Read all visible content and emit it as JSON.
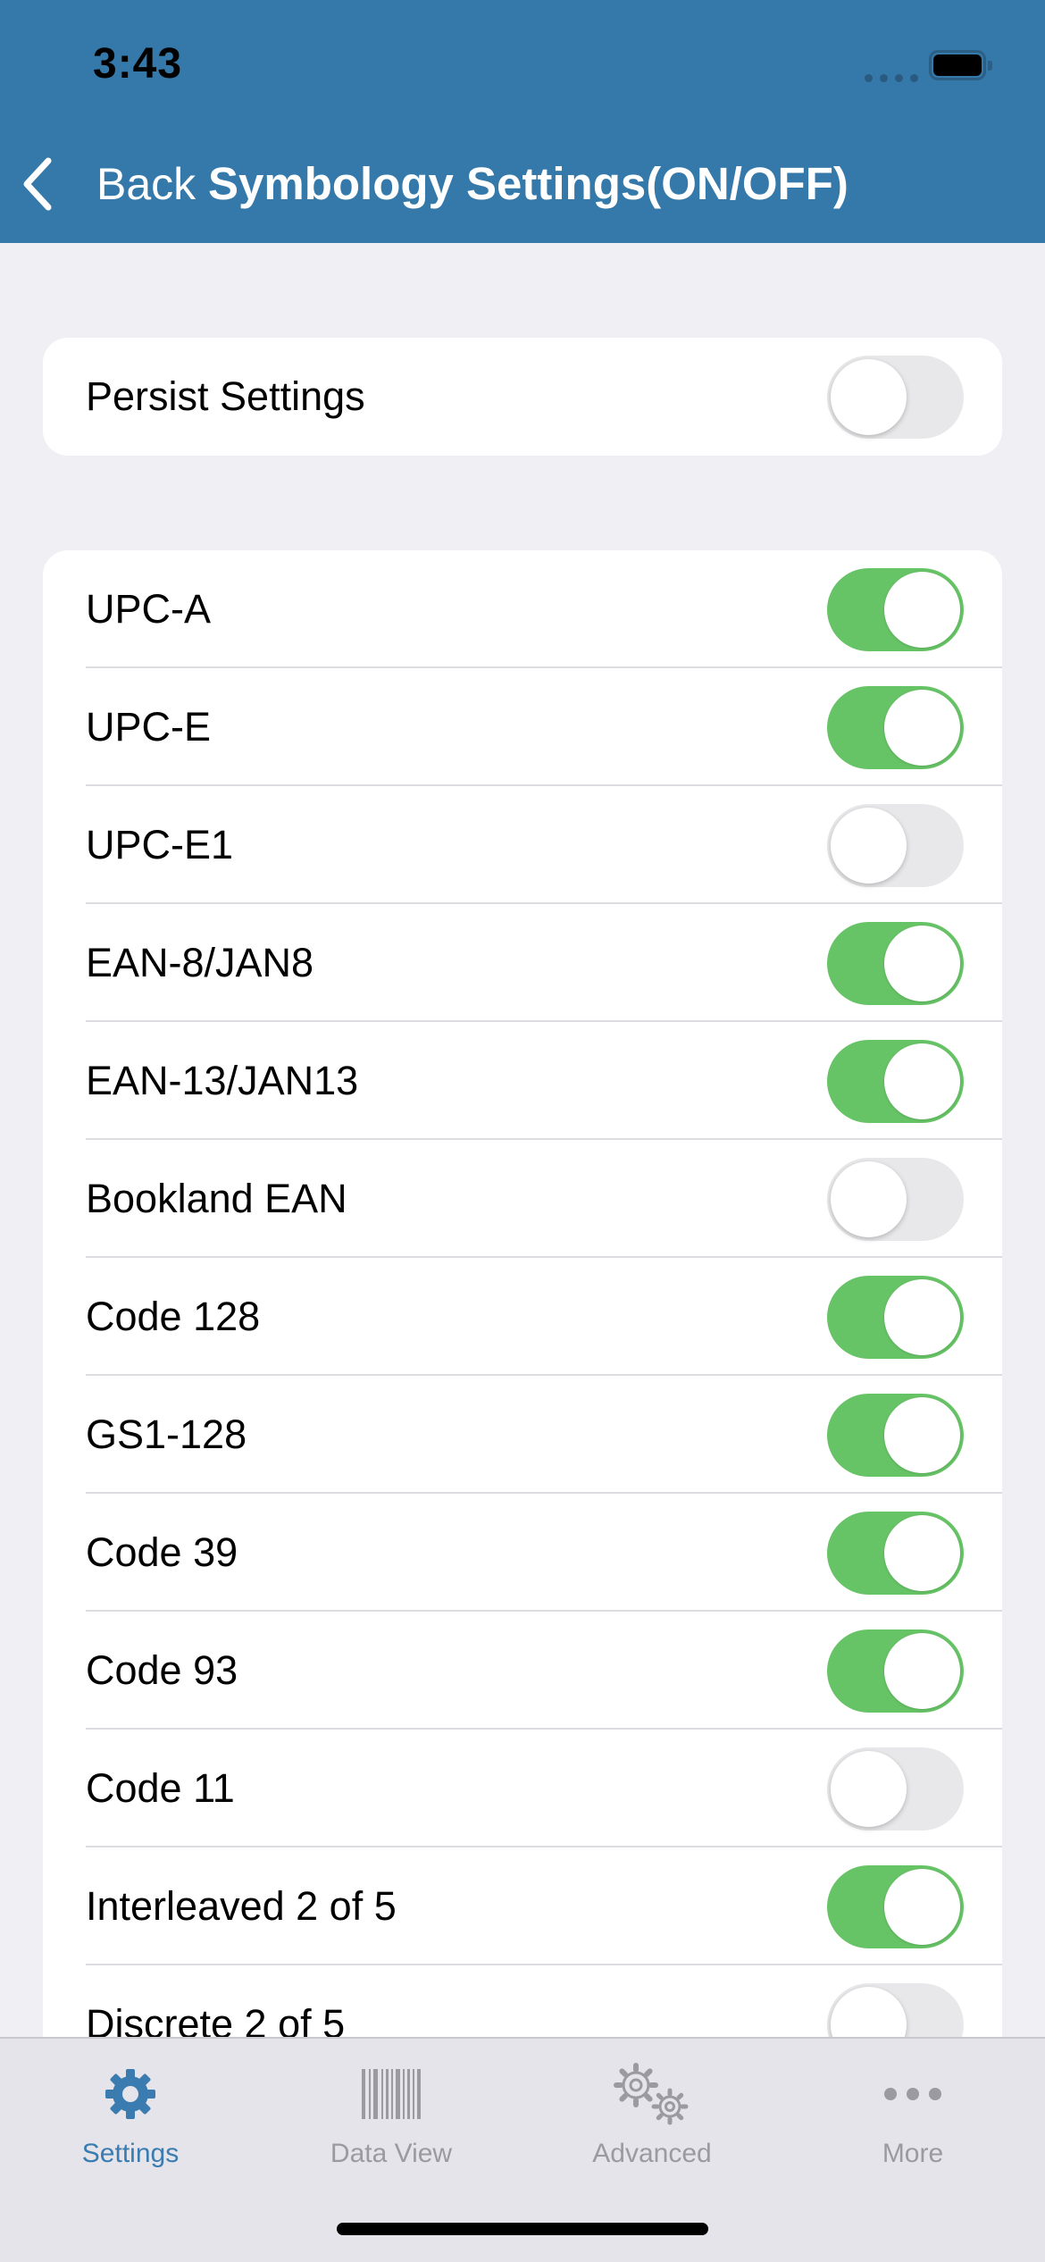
{
  "status_bar": {
    "time": "3:43"
  },
  "nav": {
    "back_label": "Back",
    "title": "Symbology Settings(ON/OFF)"
  },
  "persist": {
    "label": "Persist Settings",
    "on": false
  },
  "symbologies": [
    {
      "label": "UPC-A",
      "on": true
    },
    {
      "label": "UPC-E",
      "on": true
    },
    {
      "label": "UPC-E1",
      "on": false
    },
    {
      "label": "EAN-8/JAN8",
      "on": true
    },
    {
      "label": "EAN-13/JAN13",
      "on": true
    },
    {
      "label": "Bookland EAN",
      "on": false
    },
    {
      "label": "Code 128",
      "on": true
    },
    {
      "label": "GS1-128",
      "on": true
    },
    {
      "label": "Code 39",
      "on": true
    },
    {
      "label": "Code 93",
      "on": true
    },
    {
      "label": "Code 11",
      "on": false
    },
    {
      "label": "Interleaved 2 of 5",
      "on": true
    },
    {
      "label": "Discrete 2 of 5",
      "on": false
    }
  ],
  "tabs": [
    {
      "label": "Settings",
      "icon": "gear-icon",
      "active": true
    },
    {
      "label": "Data View",
      "icon": "barcode-icon",
      "active": false
    },
    {
      "label": "Advanced",
      "icon": "gears-icon",
      "active": false
    },
    {
      "label": "More",
      "icon": "more-icon",
      "active": false
    }
  ],
  "colors": {
    "header": "#3579aa",
    "toggle_on": "#67c466",
    "toggle_off": "#e8e8ea",
    "tab_active": "#3a7cb0",
    "tab_inactive": "#9a9aa0"
  }
}
